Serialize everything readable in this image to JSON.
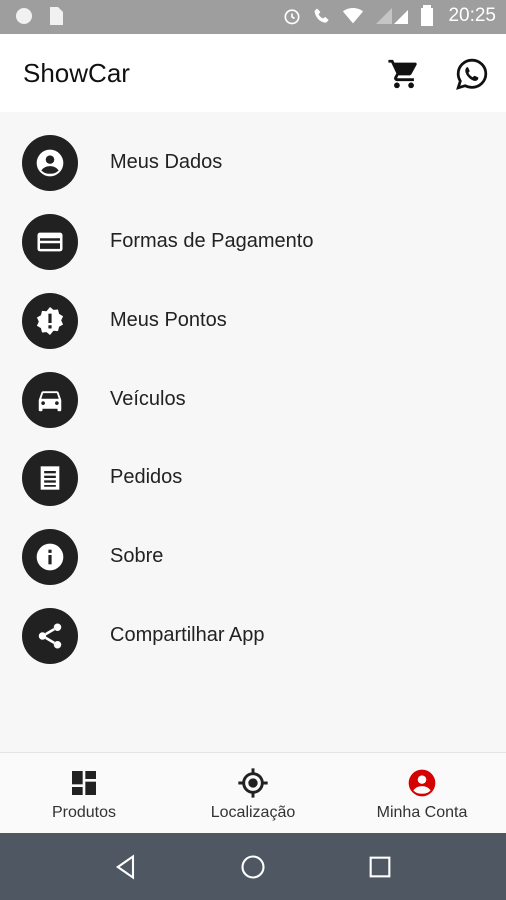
{
  "status_bar": {
    "time": "20:25"
  },
  "app_bar": {
    "title": "ShowCar",
    "cart_icon": "cart-icon",
    "whatsapp_icon": "whatsapp-icon"
  },
  "menu": [
    {
      "label": "Meus Dados",
      "icon": "account-circle-icon"
    },
    {
      "label": "Formas de Pagamento",
      "icon": "credit-card-icon"
    },
    {
      "label": "Meus Pontos",
      "icon": "badge-alert-icon"
    },
    {
      "label": "Veículos",
      "icon": "car-icon"
    },
    {
      "label": "Pedidos",
      "icon": "receipt-icon"
    },
    {
      "label": "Sobre",
      "icon": "info-icon"
    },
    {
      "label": "Compartilhar App",
      "icon": "share-icon"
    }
  ],
  "bottom_nav": [
    {
      "label": "Produtos",
      "icon": "grid-icon",
      "active": false
    },
    {
      "label": "Localização",
      "icon": "location-target-icon",
      "active": false
    },
    {
      "label": "Minha Conta",
      "icon": "account-circle-icon",
      "active": true
    }
  ],
  "colors": {
    "active": "#d50000",
    "icon_bg": "#212121",
    "status_bar": "#9e9e9e",
    "system_nav": "#4f5862"
  }
}
